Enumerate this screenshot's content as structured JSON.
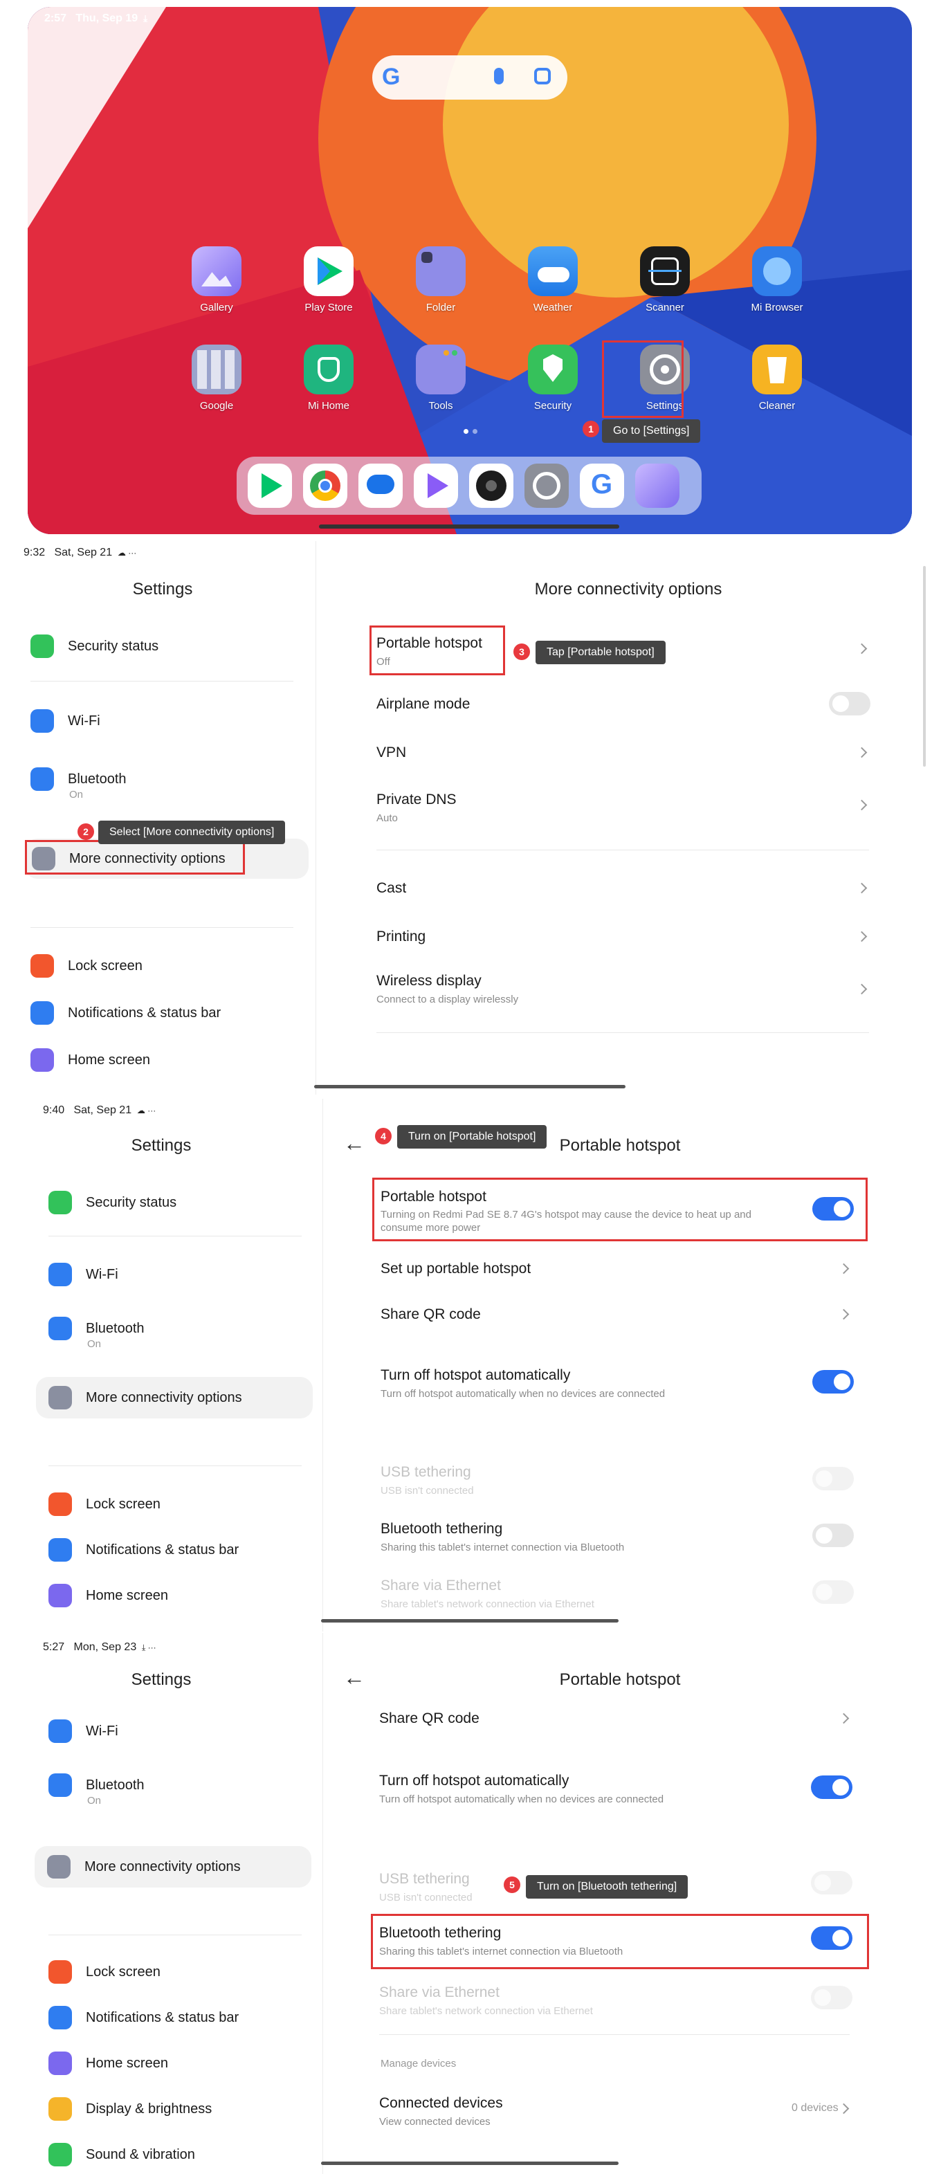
{
  "home": {
    "status_time": "2:57",
    "status_date": "Thu, Sep 19",
    "apps_row1": [
      {
        "label": "Gallery",
        "icon": "gallery-icon"
      },
      {
        "label": "Play Store",
        "icon": "play-store-icon"
      },
      {
        "label": "Folder",
        "icon": "folder-icon"
      },
      {
        "label": "Weather",
        "icon": "weather-icon"
      },
      {
        "label": "Scanner",
        "icon": "scanner-icon"
      },
      {
        "label": "Mi Browser",
        "icon": "browser-icon"
      }
    ],
    "apps_row2": [
      {
        "label": "Google",
        "icon": "google-folder-icon"
      },
      {
        "label": "Mi Home",
        "icon": "mi-home-icon"
      },
      {
        "label": "Tools",
        "icon": "tools-folder-icon"
      },
      {
        "label": "Security",
        "icon": "security-icon"
      },
      {
        "label": "Settings",
        "icon": "settings-icon"
      },
      {
        "label": "Cleaner",
        "icon": "cleaner-icon"
      }
    ],
    "dock_icons": [
      "play-store-icon",
      "chrome-icon",
      "messages-icon",
      "play-games-icon",
      "camera-icon",
      "settings-icon",
      "google-icon",
      "gallery-icon"
    ],
    "step_badge": "1",
    "step_tip": "Go to [Settings]"
  },
  "s2": {
    "status_time": "9:32",
    "status_date": "Sat, Sep 21",
    "left_title": "Settings",
    "right_title": "More connectivity options",
    "left_items": [
      {
        "label": "Security status",
        "sub": ""
      },
      {
        "label": "Wi-Fi",
        "sub": ""
      },
      {
        "label": "Bluetooth",
        "sub": "On"
      },
      {
        "label": "More connectivity options",
        "sub": ""
      },
      {
        "label": "Lock screen",
        "sub": ""
      },
      {
        "label": "Notifications & status bar",
        "sub": ""
      },
      {
        "label": "Home screen",
        "sub": ""
      }
    ],
    "right_items": [
      {
        "label": "Portable hotspot",
        "sub": "Off"
      },
      {
        "label": "Airplane mode",
        "sub": ""
      },
      {
        "label": "VPN",
        "sub": ""
      },
      {
        "label": "Private DNS",
        "sub": "Auto"
      },
      {
        "label": "Cast",
        "sub": ""
      },
      {
        "label": "Printing",
        "sub": ""
      },
      {
        "label": "Wireless display",
        "sub": "Connect to a display wirelessly"
      }
    ],
    "step2_badge": "2",
    "step2_tip": "Select [More connectivity options]",
    "step3_badge": "3",
    "step3_tip": "Tap [Portable hotspot]"
  },
  "s3": {
    "status_time": "9:40",
    "status_date": "Sat, Sep 21",
    "left_title": "Settings",
    "right_title": "Portable hotspot",
    "left_items": [
      {
        "label": "Security status",
        "sub": ""
      },
      {
        "label": "Wi-Fi",
        "sub": ""
      },
      {
        "label": "Bluetooth",
        "sub": "On"
      },
      {
        "label": "More connectivity options",
        "sub": ""
      },
      {
        "label": "Lock screen",
        "sub": ""
      },
      {
        "label": "Notifications & status bar",
        "sub": ""
      },
      {
        "label": "Home screen",
        "sub": ""
      }
    ],
    "right_items": [
      {
        "label": "Portable hotspot",
        "sub": "Turning on Redmi Pad SE 8.7 4G's hotspot may cause the device to heat up and consume more power"
      },
      {
        "label": "Set up portable hotspot",
        "sub": ""
      },
      {
        "label": "Share QR code",
        "sub": ""
      },
      {
        "label": "Turn off hotspot automatically",
        "sub": "Turn off hotspot automatically when no devices are connected"
      },
      {
        "label": "USB tethering",
        "sub": "USB isn't connected"
      },
      {
        "label": "Bluetooth tethering",
        "sub": "Sharing this tablet's internet connection via Bluetooth"
      },
      {
        "label": "Share via Ethernet",
        "sub": "Share tablet's network connection via Ethernet"
      }
    ],
    "step4_badge": "4",
    "step4_tip": "Turn on [Portable hotspot]"
  },
  "s4": {
    "status_time": "5:27",
    "status_date": "Mon, Sep 23",
    "left_title": "Settings",
    "right_title": "Portable hotspot",
    "left_items": [
      {
        "label": "Wi-Fi",
        "sub": ""
      },
      {
        "label": "Bluetooth",
        "sub": "On"
      },
      {
        "label": "More connectivity options",
        "sub": ""
      },
      {
        "label": "Lock screen",
        "sub": ""
      },
      {
        "label": "Notifications & status bar",
        "sub": ""
      },
      {
        "label": "Home screen",
        "sub": ""
      },
      {
        "label": "Display & brightness",
        "sub": ""
      },
      {
        "label": "Sound & vibration",
        "sub": ""
      }
    ],
    "right_items": [
      {
        "label": "Share QR code",
        "sub": ""
      },
      {
        "label": "Turn off hotspot automatically",
        "sub": "Turn off hotspot automatically when no devices are connected"
      },
      {
        "label": "USB tethering",
        "sub": "USB isn't connected"
      },
      {
        "label": "Bluetooth tethering",
        "sub": "Sharing this tablet's internet connection via Bluetooth"
      },
      {
        "label": "Share via Ethernet",
        "sub": "Share tablet's network connection via Ethernet"
      },
      {
        "label": "Connected devices",
        "sub": "View connected devices"
      }
    ],
    "manage_label": "Manage devices",
    "connected_value": "0 devices",
    "step5_badge": "5",
    "step5_tip": "Turn on [Bluetooth tethering]"
  },
  "colors": {
    "accent": "#2a6ff2",
    "highlight": "#e03535",
    "tooltip_bg": "#444444"
  }
}
